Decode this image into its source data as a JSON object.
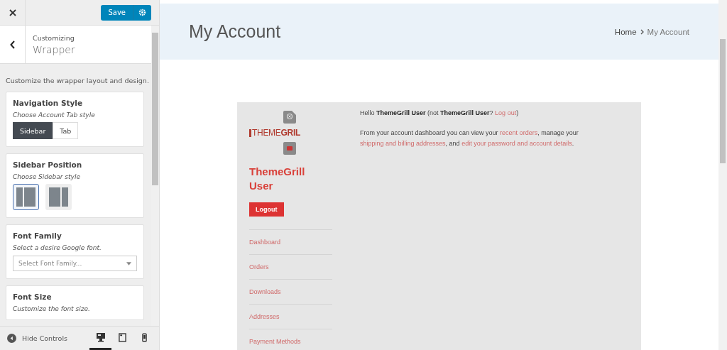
{
  "customizer": {
    "save_label": "Save",
    "breadcrumb": "Customizing",
    "section_title": "Wrapper",
    "description": "Customize the wrapper layout and design.",
    "controls": [
      {
        "kind": "segmented",
        "title": "Navigation Style",
        "hint": "Choose Account Tab style",
        "options": [
          {
            "label": "Sidebar",
            "selected": true
          },
          {
            "label": "Tab",
            "selected": false
          }
        ]
      },
      {
        "kind": "layout",
        "title": "Sidebar Position",
        "hint": "Choose Sidebar style",
        "options": [
          {
            "selected": true
          },
          {
            "selected": false
          }
        ]
      },
      {
        "kind": "select",
        "title": "Font Family",
        "hint": "Select a desire Google font.",
        "placeholder": "Select Font Family..."
      },
      {
        "kind": "text",
        "title": "Font Size",
        "hint": "Customize the font size."
      }
    ],
    "footer": {
      "label": "Hide Controls",
      "devices": [
        {
          "kind": "desktop",
          "selected": true
        },
        {
          "kind": "tablet",
          "selected": false
        },
        {
          "kind": "mobile",
          "selected": false
        }
      ]
    }
  },
  "preview": {
    "page_title": "My Account",
    "breadcrumbs": [
      {
        "label": "Home",
        "current": false
      },
      {
        "label": "My Account",
        "current": true
      }
    ],
    "account": {
      "logo": "THEME**GRIL**",
      "user_name": "ThemeGrill User",
      "logout_label": "Logout",
      "nav": [
        "Dashboard",
        "Orders",
        "Downloads",
        "Addresses",
        "Payment Methods"
      ],
      "paragraphs": [
        [
          {
            "kind": "text",
            "text": "Hello "
          },
          {
            "kind": "bold",
            "text": "ThemeGrill User"
          },
          {
            "kind": "text",
            "text": " (not "
          },
          {
            "kind": "bold",
            "text": "ThemeGrill User"
          },
          {
            "kind": "text",
            "text": "? "
          },
          {
            "kind": "link",
            "text": "Log out"
          },
          {
            "kind": "text",
            "text": ")"
          }
        ],
        [
          {
            "kind": "text",
            "text": "From your account dashboard you can view your "
          },
          {
            "kind": "link",
            "text": "recent orders"
          },
          {
            "kind": "text",
            "text": ", manage your "
          },
          {
            "kind": "link",
            "text": "shipping and billing addresses"
          },
          {
            "kind": "text",
            "text": ", and "
          },
          {
            "kind": "link",
            "text": "edit your password and account details"
          },
          {
            "kind": "text",
            "text": "."
          }
        ]
      ]
    }
  }
}
